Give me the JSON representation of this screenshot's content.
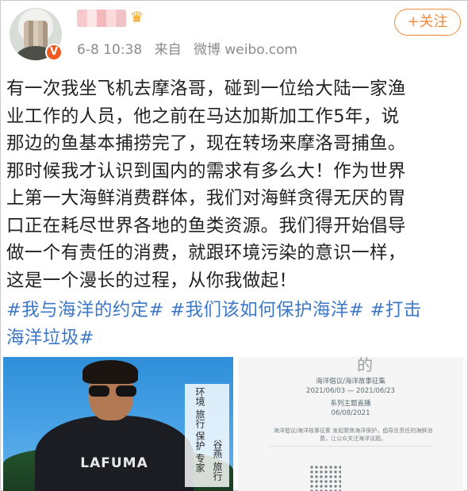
{
  "post": {
    "author_badge": "V",
    "timestamp": "6-8 10:38",
    "source_prefix": "来自",
    "source_name": "微博 weibo.com",
    "follow_label": "+关注",
    "lines": [
      "有一次我坐飞机去摩洛哥，碰到一位给大陆一家渔",
      "业工作的人员，他之前在马达加斯加工作5年，说",
      "那边的鱼基本捕捞完了，现在转场来摩洛哥捕鱼。",
      "那时候我才认识到国内的需求有多么大！作为世界",
      "上第一大海鲜消费群体，我们对海鲜贪得无厌的胃",
      "口正在耗尽世界各地的鱼类资源。我们得开始倡导",
      "做一个有责任的消费，就跟环境污染的意识一样，",
      "这是一个漫长的过程，从你我做起！"
    ],
    "tags": [
      "#我与海洋的约定#",
      "#我们该如何保护海洋#",
      "#打击海洋垃圾#"
    ],
    "tag_line1": "#我与海洋的约定# #我们该如何保护海洋# #打击",
    "tag_line2": "海洋垃圾#"
  },
  "image1": {
    "shirt_logo": "LAFUMA",
    "vertical_text_1": "环境 旅行 保护 专家",
    "vertical_text_2": "谷燕 旅行"
  },
  "image2": {
    "title": "的",
    "event_name": "海洋倡议/海洋故事征集",
    "event_dates": "2021/06/03 — 2021/06/23",
    "topic_label": "系列主题直播",
    "topic_date": "06/08/2021",
    "paragraph": "海洋倡议/海洋故事征集 发起聚焦海洋保护，倡导负责任的海鲜消费，让公众关注海洋议题。"
  },
  "colors": {
    "accent_orange": "#f08b3c",
    "topic_blue": "#3d78c6",
    "verified_orange": "#f05a23",
    "meta_gray": "#8c8c8c"
  }
}
